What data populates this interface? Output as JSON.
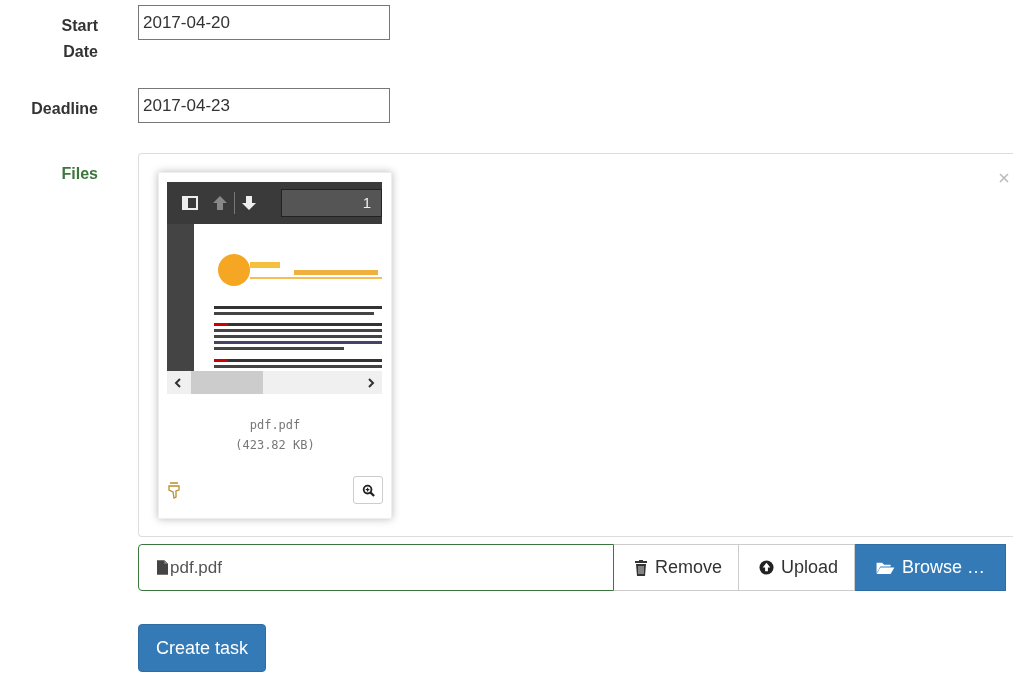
{
  "fields": [
    {
      "label": "Start Date",
      "value": "2017-04-20"
    },
    {
      "label": "Deadline",
      "value": "2017-04-23"
    }
  ],
  "files": {
    "label": "Files",
    "preview": {
      "page_number": "1",
      "file_name": "pdf.pdf",
      "file_size": "(423.82 KB)"
    },
    "caption": "pdf.pdf",
    "buttons": [
      {
        "kind": "remove",
        "label": "Remove"
      },
      {
        "kind": "upload",
        "label": "Upload"
      },
      {
        "kind": "browse",
        "label": "Browse …"
      }
    ]
  },
  "submit": "Create task"
}
